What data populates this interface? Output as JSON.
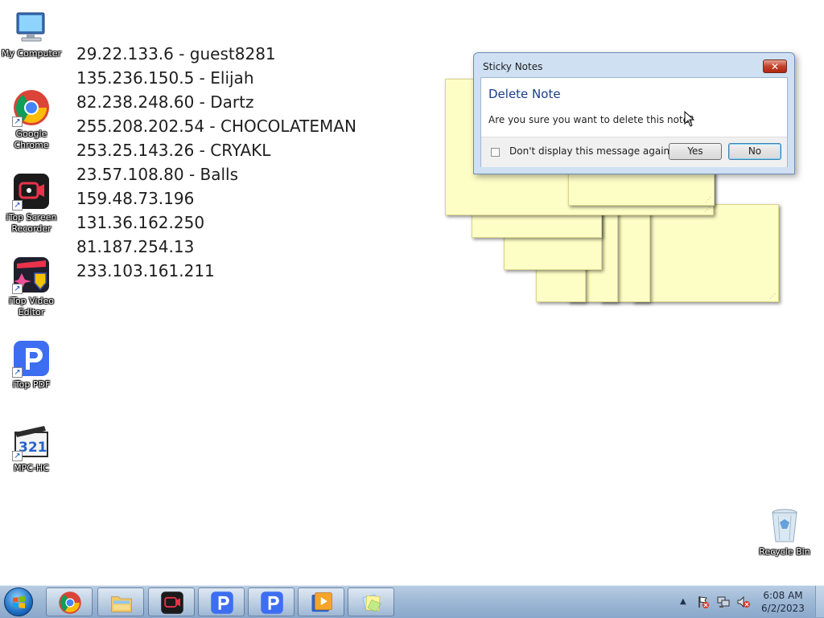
{
  "desktop": {
    "icons": [
      {
        "label": "My Computer",
        "icon": "computer-icon"
      },
      {
        "label": "Google Chrome",
        "icon": "chrome-icon"
      },
      {
        "label": "iTop Screen Recorder",
        "icon": "screen-recorder-icon"
      },
      {
        "label": "iTop Video Editor",
        "icon": "video-editor-icon"
      },
      {
        "label": "iTop PDF",
        "icon": "pdf-icon"
      },
      {
        "label": "MPC-HC",
        "icon": "mpc-hc-icon"
      },
      {
        "label": "Recycle Bin",
        "icon": "recycle-bin-icon"
      }
    ]
  },
  "note": {
    "lines": [
      "29.22.133.6 - guest8281",
      "135.236.150.5 - Elijah",
      "82.238.248.60 - Dartz",
      "255.208.202.54 - CHOCOLATEMAN",
      "253.25.143.26 - CRYAKL",
      "23.57.108.80 - Balls",
      "159.48.73.196",
      "131.36.162.250",
      "81.187.254.13",
      "233.103.161.211"
    ]
  },
  "dialog": {
    "title": "Sticky Notes",
    "close_glyph": "✕",
    "heading": "Delete Note",
    "message": "Are you sure you want to delete this note?",
    "checkbox_label": "Don't display this message again",
    "checkbox_checked": false,
    "yes_label": "Yes",
    "no_label": "No"
  },
  "taskbar": {
    "items": [
      "start-orb",
      "chrome-icon",
      "file-explorer-icon",
      "screen-recorder-icon",
      "pdf-icon",
      "pdf-icon",
      "video-player-icon",
      "sticky-notes-icon"
    ],
    "tray_arrow": "▲",
    "time": "6:08 AM",
    "date": "6/2/2023"
  },
  "colors": {
    "sticky_note": "#fdfdc6",
    "dialog_frame": "#cfe0f3",
    "dialog_heading": "#1a3d8a",
    "taskbar": "#9fb9d6"
  }
}
